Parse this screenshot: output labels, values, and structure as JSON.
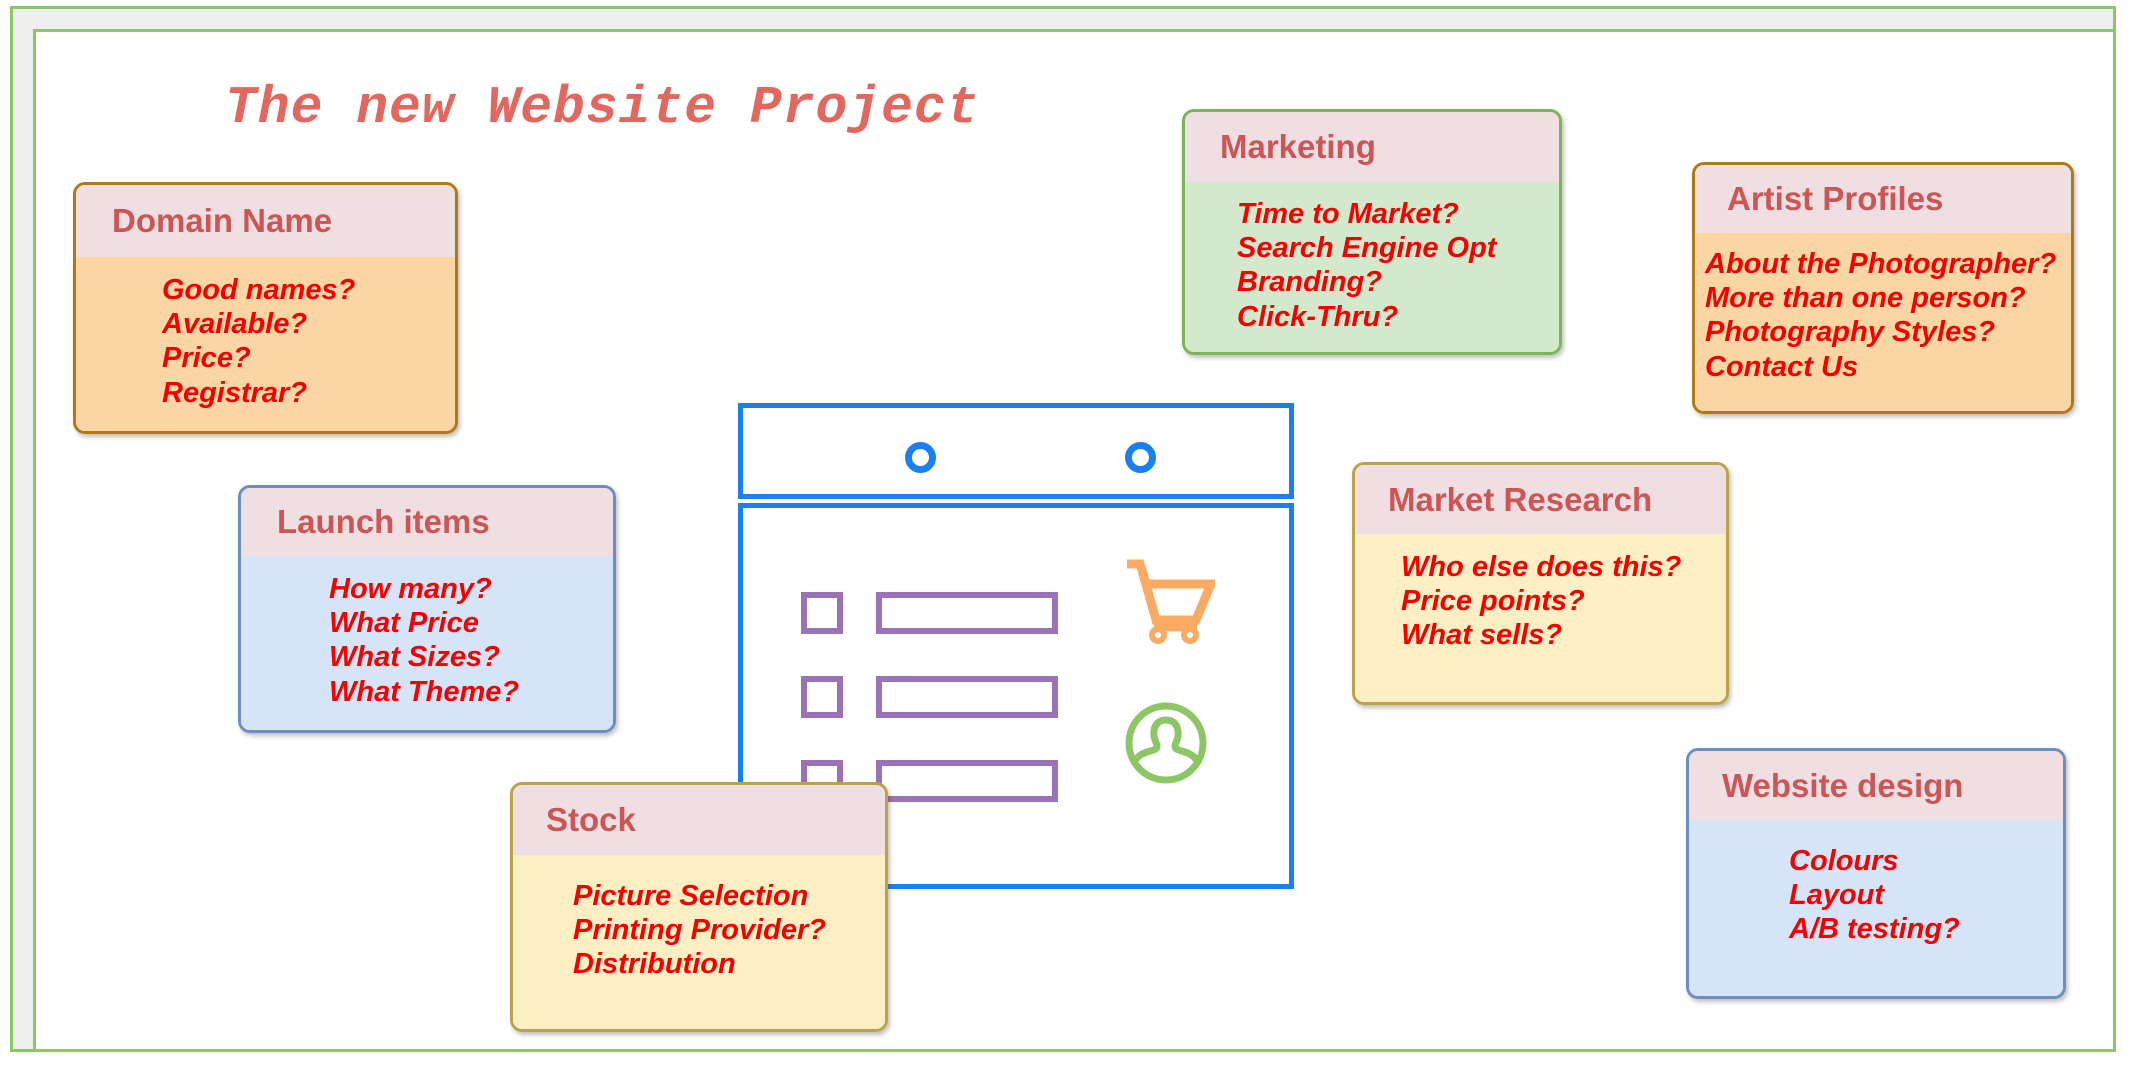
{
  "page": {
    "title": "The new Website Project",
    "title_color": "#e2685f",
    "frame_color": "#8cc665"
  },
  "cards": [
    {
      "id": "domain-name",
      "title": "Domain Name",
      "accent": "#b07818",
      "body_color": "#fad6a5",
      "lines": [
        "Good names?",
        "Available?",
        "Price?",
        "Registrar?"
      ]
    },
    {
      "id": "marketing",
      "title": "Marketing",
      "accent": "#7ab55c",
      "body_color": "#d4e8cc",
      "lines": [
        "Time to Market?",
        "Search Engine Opt",
        "Branding?",
        "Click-Thru?"
      ]
    },
    {
      "id": "artist-profiles",
      "title": "Artist Profiles",
      "accent": "#b07818",
      "body_color": "#fad6a5",
      "lines": [
        "About the Photographer?",
        "More than one person?",
        "Photography Styles?",
        "Contact Us"
      ]
    },
    {
      "id": "launch-items",
      "title": "Launch items",
      "accent": "#6b8fc0",
      "body_color": "#d6e4f7",
      "lines": [
        "How many?",
        "What Price",
        "What Sizes?",
        "What Theme?"
      ]
    },
    {
      "id": "market-research",
      "title": "Market Research",
      "accent": "#bba34a",
      "body_color": "#fcefc3",
      "lines": [
        "Who else does this?",
        "Price points?",
        "What sells?"
      ]
    },
    {
      "id": "website-design",
      "title": "Website design",
      "accent": "#6b8fc0",
      "body_color": "#d6e4f7",
      "lines": [
        "Colours",
        "Layout",
        "A/B testing?"
      ]
    },
    {
      "id": "stock",
      "title": "Stock",
      "accent": "#bba34a",
      "body_color": "#fcefc3",
      "lines": [
        "Picture Selection",
        "Printing Provider?",
        "Distribution"
      ]
    }
  ],
  "mockup": {
    "name": "website-mockup",
    "frame_color": "#1a7ff0",
    "field_color": "#9b72b5",
    "cart_color": "#f9ab63",
    "user_color": "#8cc665",
    "titlebar_dots": 2,
    "form_rows": 3,
    "icons": [
      "shopping-cart-icon",
      "user-account-icon"
    ]
  }
}
